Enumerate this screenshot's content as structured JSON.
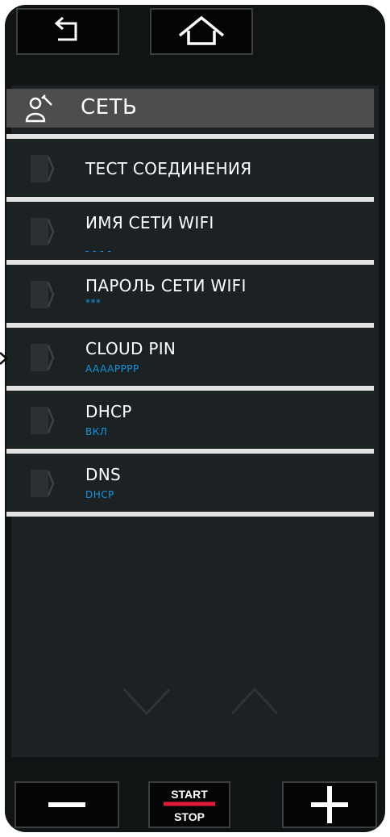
{
  "toolbar": {
    "back_icon": "back-arrow-icon",
    "home_icon": "home-icon"
  },
  "header": {
    "icon": "network-settings-icon",
    "title": "СЕТЬ"
  },
  "menu": [
    {
      "label": "ТЕСТ СОЕДИНЕНИЯ",
      "value": ""
    },
    {
      "label": "ИМЯ СЕТИ WIFI",
      "value": "- - - -"
    },
    {
      "label": "ПАРОЛЬ СЕТИ WIFI",
      "value": "***"
    },
    {
      "label": "CLOUD PIN",
      "value": "AAAAPPPP"
    },
    {
      "label": "DHCP",
      "value": "ВКЛ"
    },
    {
      "label": "DNS",
      "value": "DHCP"
    }
  ],
  "scroll": {
    "down_icon": "chevron-down-icon",
    "up_icon": "chevron-up-icon"
  },
  "bottom": {
    "minus_icon": "minus-icon",
    "start_label": "START",
    "stop_label": "STOP",
    "plus_icon": "plus-icon"
  },
  "colors": {
    "background": "#111415",
    "panel": "#1c2124",
    "header": "#4d4d4d",
    "separator": "#e3e3e3",
    "value_text": "#1596e0",
    "start_stop_bar": "#e0193a"
  }
}
